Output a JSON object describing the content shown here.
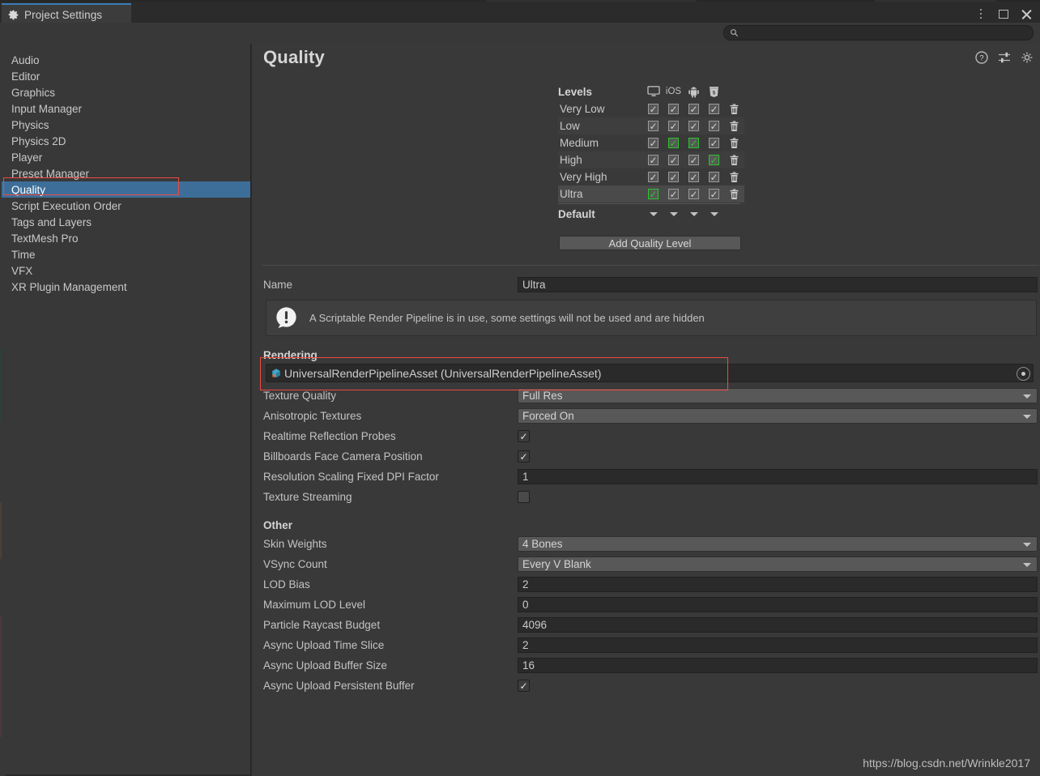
{
  "window": {
    "tab_label": "Project Settings",
    "tab_icon": "gear-icon",
    "controls": {
      "menu": "kebab-menu-icon",
      "maximize": "maximize-icon",
      "close": "close-icon"
    }
  },
  "search": {
    "value": "",
    "placeholder": "",
    "icon": "search-icon"
  },
  "sidebar": {
    "items": [
      {
        "label": "Audio",
        "selected": false
      },
      {
        "label": "Editor",
        "selected": false
      },
      {
        "label": "Graphics",
        "selected": false
      },
      {
        "label": "Input Manager",
        "selected": false
      },
      {
        "label": "Physics",
        "selected": false
      },
      {
        "label": "Physics 2D",
        "selected": false
      },
      {
        "label": "Player",
        "selected": false
      },
      {
        "label": "Preset Manager",
        "selected": false
      },
      {
        "label": "Quality",
        "selected": true
      },
      {
        "label": "Script Execution Order",
        "selected": false
      },
      {
        "label": "Tags and Layers",
        "selected": false
      },
      {
        "label": "TextMesh Pro",
        "selected": false
      },
      {
        "label": "Time",
        "selected": false
      },
      {
        "label": "VFX",
        "selected": false
      },
      {
        "label": "XR Plugin Management",
        "selected": false
      }
    ]
  },
  "header": {
    "title": "Quality",
    "icons": [
      "help-icon",
      "preset-icon",
      "gear-icon"
    ]
  },
  "levels": {
    "header_label": "Levels",
    "platforms": [
      {
        "name": "standalone-icon",
        "label": ""
      },
      {
        "name": "ios-icon",
        "label": "iOS"
      },
      {
        "name": "android-icon",
        "label": ""
      },
      {
        "name": "webgl-html5-icon",
        "label": ""
      }
    ],
    "rows": [
      {
        "label": "Very Low",
        "checks": [
          false,
          false,
          false,
          false
        ],
        "selected": false
      },
      {
        "label": "Low",
        "checks": [
          false,
          false,
          false,
          false
        ],
        "selected": false
      },
      {
        "label": "Medium",
        "checks": [
          false,
          true,
          true,
          false
        ],
        "selected": false
      },
      {
        "label": "High",
        "checks": [
          false,
          false,
          false,
          true
        ],
        "selected": false
      },
      {
        "label": "Very High",
        "checks": [
          false,
          false,
          false,
          false
        ],
        "selected": false
      },
      {
        "label": "Ultra",
        "checks": [
          true,
          false,
          false,
          false
        ],
        "selected": true
      }
    ],
    "default_label": "Default",
    "add_button": "Add Quality Level",
    "check_glyph": "✓",
    "delete_icon": "trash-icon"
  },
  "name_row": {
    "label": "Name",
    "value": "Ultra"
  },
  "warning": {
    "icon": "warning-icon",
    "text": "A Scriptable Render Pipeline is in use, some settings will not be used and are hidden"
  },
  "rendering": {
    "section_label": "Rendering",
    "pipeline_asset": {
      "label": "",
      "value": "UniversalRenderPipelineAsset (UniversalRenderPipelineAsset)",
      "icon": "scriptable-object-icon",
      "picker_icon": "object-picker-icon",
      "highlighted": true,
      "highlight_color": "#ef4a42"
    },
    "rows": [
      {
        "label": "Texture Quality",
        "type": "dropdown",
        "value": "Full Res"
      },
      {
        "label": "Anisotropic Textures",
        "type": "dropdown",
        "value": "Forced On"
      },
      {
        "label": "Realtime Reflection Probes",
        "type": "checkbox",
        "value": true
      },
      {
        "label": "Billboards Face Camera Position",
        "type": "checkbox",
        "value": true
      },
      {
        "label": "Resolution Scaling Fixed DPI Factor",
        "type": "text",
        "value": "1"
      },
      {
        "label": "Texture Streaming",
        "type": "checkbox",
        "value": false
      }
    ]
  },
  "other": {
    "section_label": "Other",
    "rows": [
      {
        "label": "Skin Weights",
        "type": "dropdown",
        "value": "4 Bones"
      },
      {
        "label": "VSync Count",
        "type": "dropdown",
        "value": "Every V Blank"
      },
      {
        "label": "LOD Bias",
        "type": "text",
        "value": "2"
      },
      {
        "label": "Maximum LOD Level",
        "type": "text",
        "value": "0"
      },
      {
        "label": "Particle Raycast Budget",
        "type": "text",
        "value": "4096"
      },
      {
        "label": "Async Upload Time Slice",
        "type": "text",
        "value": "2"
      },
      {
        "label": "Async Upload Buffer Size",
        "type": "text",
        "value": "16"
      },
      {
        "label": "Async Upload Persistent Buffer",
        "type": "checkbox",
        "value": true
      }
    ]
  },
  "watermark": "https://blog.csdn.net/Wrinkle2017",
  "colors": {
    "accent": "#3d6e99",
    "annotation": "#ef4a42",
    "check_on": "#2fc32f",
    "bg": "#393939"
  }
}
